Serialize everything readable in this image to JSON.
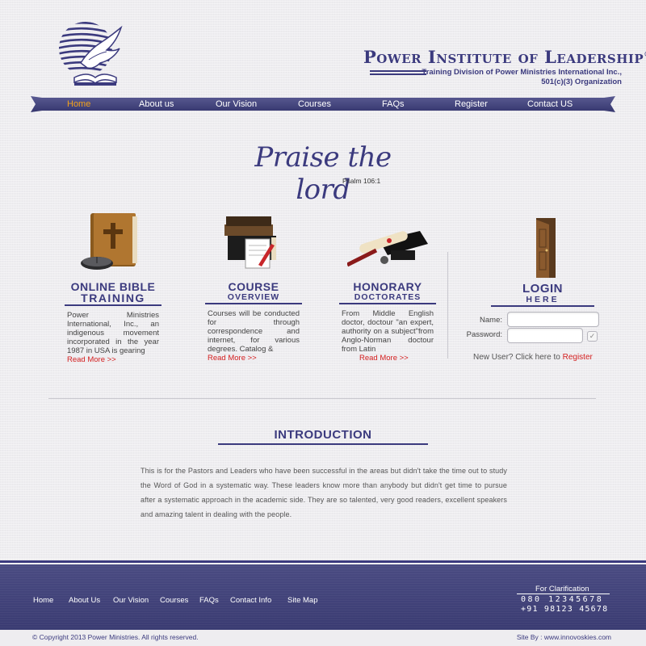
{
  "brand": {
    "title": "Power Institute of Leadership",
    "trademark": "®",
    "subtitle_line1": "Training Division of Power Ministries International Inc.,",
    "subtitle_line2": "501(c)(3) Organization",
    "logo_icon": "dove-over-bible-logo"
  },
  "nav": {
    "items": [
      {
        "label": "Home",
        "active": true
      },
      {
        "label": "About us"
      },
      {
        "label": "Our Vision"
      },
      {
        "label": "Courses"
      },
      {
        "label": "FAQs"
      },
      {
        "label": "Register"
      },
      {
        "label": "Contact US"
      }
    ]
  },
  "hero": {
    "script": "Praise the lord",
    "reference": "Psalm 106:1"
  },
  "features": [
    {
      "icon": "bible-with-mouse-icon",
      "title": "ONLINE BIBLE",
      "subtitle": "TRAINING",
      "text": "Power Ministries International, Inc., an indigenous movement incorporated in the year 1987 in USA is gearing",
      "read_more": "Read More >>"
    },
    {
      "icon": "books-and-notepad-icon",
      "title": "COURSE",
      "subtitle": "OVERVIEW",
      "text": "Courses will be conducted for through correspondence and internet, for various degrees. Catalog &",
      "read_more": "Read More >>"
    },
    {
      "icon": "graduation-cap-diploma-icon",
      "title": "HONORARY",
      "subtitle": "DOCTORATES",
      "text": "From Middle English doctor, doctour \"an expert, authority on a subject\"from Anglo-Norman doctour from Latin",
      "read_more": "Read More >>"
    }
  ],
  "login": {
    "icon": "open-door-icon",
    "title": "LOGIN",
    "subtitle": "HERE",
    "name_label": "Name:",
    "name_value": "",
    "password_label": "Password:",
    "password_value": "",
    "submit_glyph": "✓",
    "new_user_text": "New User? Click here to ",
    "register_link": "Register"
  },
  "intro": {
    "title": "INTRODUCTION",
    "text": "This is for the Pastors and Leaders who have been successful in the areas but didn't take the time out to study the Word of God in a systematic way. These leaders know more than anybody but didn't get time to pursue after a systematic approach in the academic side. They are so talented, very good readers, excellent speakers and amazing talent in dealing with the people."
  },
  "footer": {
    "links": [
      "Home",
      "About Us",
      "Our Vision",
      "Courses",
      "FAQs",
      "Contact Info",
      "Site Map"
    ],
    "clarification_title": "For Clarification",
    "phone1": "080 12345678",
    "phone2": "+91 98123 45678",
    "copyright": "© Copyright 2013 Power Ministries. All rights reserved.",
    "site_by": "Site By : www.innovoskies.com"
  },
  "colors": {
    "brand_navy": "#3b3a7e",
    "accent_orange": "#f3a21c",
    "link_red": "#d42020",
    "footer_bg": "#42437a"
  }
}
